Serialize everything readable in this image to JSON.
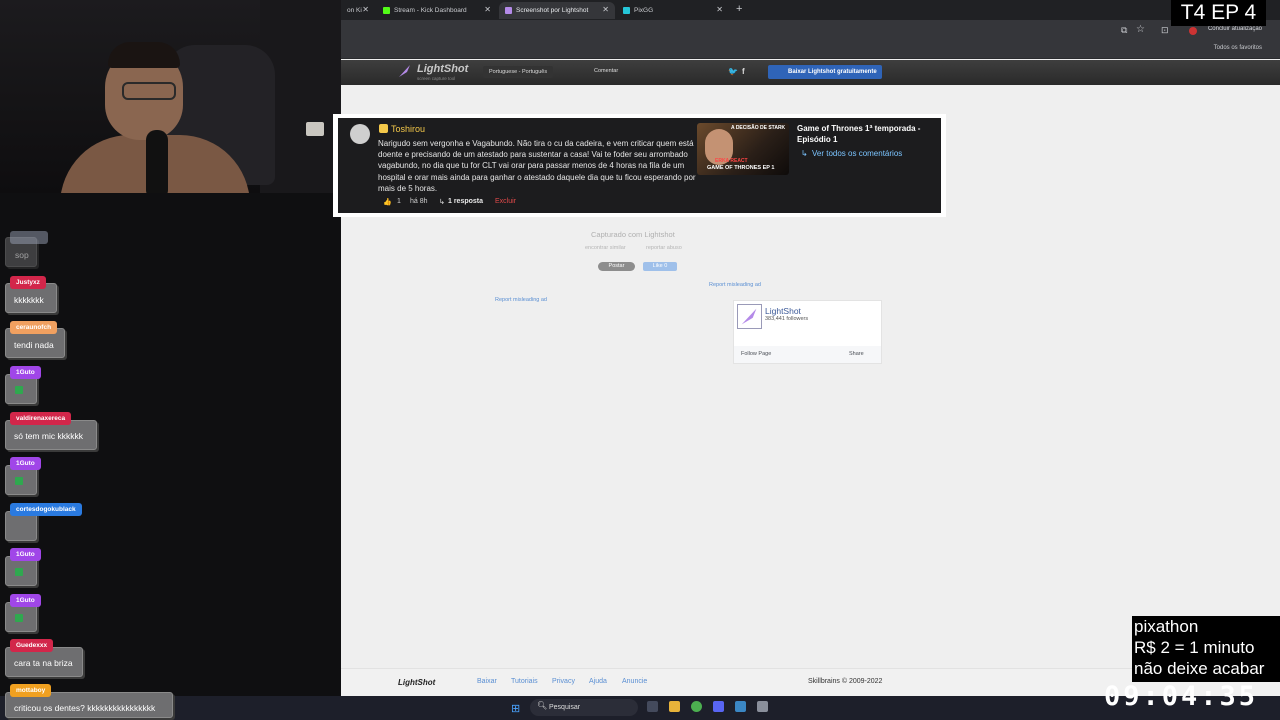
{
  "overlay": {
    "episode_label": "T4 EP 4",
    "pixathon": [
      "pixathon",
      "R$ 2 = 1 minuto",
      "não deixe acabar"
    ],
    "timer": "09:04:35"
  },
  "browser": {
    "tabs": [
      {
        "label": "on Ki"
      },
      {
        "label": "Stream - Kick Dashboard"
      },
      {
        "label": "Screenshot por Lightshot"
      },
      {
        "label": "PixGG"
      }
    ],
    "new_tab": "+",
    "update_label": "Concluir atualização",
    "favorites_label": "Todos os favoritos"
  },
  "lightshot": {
    "logo": "LightShot",
    "slogan": "screen capture tool",
    "language": "Portuguese - Português",
    "comment_link": "Comentar",
    "download_button": "Baixar Lightshot gratuitamente",
    "captured_with": "Capturado com Lightshot",
    "similar": "encontrar similar",
    "report_abuse": "reportar abuso",
    "post_button": "Postar",
    "like_button": "Like 0",
    "report_ad_1": "Report misleading ad",
    "report_ad_2": "Report misleading ad",
    "fb_page_name": "LightShot",
    "fb_followers": "383,441 followers",
    "fb_follow": "Follow Page",
    "fb_share": "Share",
    "footer": {
      "logo": "LightShot",
      "links": [
        "Baixar",
        "Tutoriais",
        "Privacy",
        "Ajuda",
        "Anuncie"
      ],
      "copyright": "Skillbrains © 2009-2022"
    }
  },
  "screenshot_comment": {
    "username": "Toshirou",
    "text": "Narigudo sem vergonha e Vagabundo. Não tira o cu da cadeira, e vem criticar quem está doente e precisando de um atestado para sustentar a casa! Vai te foder seu arrombado vagabundo, no dia que tu for CLT vai orar para passar menos de 4 horas na fila de um hospital e orar mais ainda para ganhar o atestado daquele dia que tu ficou esperando por mais de 5 horas.",
    "likes": "1",
    "time_ago": "há 8h",
    "replies": "1 resposta",
    "delete": "Excluir",
    "video_title": "Game of Thrones 1ª temporada - Episódio 1",
    "see_all": "Ver todos os comentários",
    "thumb_text_1": "A DECISÃO DE STARK",
    "thumb_text_2": "ERKA REACT",
    "thumb_text_3": "GAME OF THRONES EP 1"
  },
  "chat": [
    {
      "user": "",
      "text": "sop",
      "color": "#9aa2b5"
    },
    {
      "user": "Justyxz",
      "text": "kkkkkkk",
      "color": "#d2264a"
    },
    {
      "user": "ceraunofch",
      "text": "tendi nada",
      "color": "#f0a060"
    },
    {
      "user": "1Guto",
      "text": "",
      "color": "#a046e8"
    },
    {
      "user": "valdirenaxereca",
      "text": "só tem mic kkkkkk",
      "color": "#d2264a"
    },
    {
      "user": "1Guto",
      "text": "",
      "color": "#a046e8"
    },
    {
      "user": "cortesdogokublack",
      "text": "",
      "color": "#2a7ae0"
    },
    {
      "user": "1Guto",
      "text": "",
      "color": "#a046e8"
    },
    {
      "user": "1Guto",
      "text": "",
      "color": "#a046e8"
    },
    {
      "user": "Guedexxx",
      "text": "cara ta na briza",
      "color": "#d2264a"
    },
    {
      "user": "mottaboy",
      "text": "criticou os dentes? kkkkkkkkkkkkkkkk",
      "color": "#f0a020"
    }
  ],
  "taskbar": {
    "search_placeholder": "Pesquisar"
  }
}
